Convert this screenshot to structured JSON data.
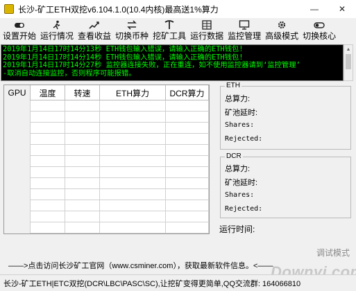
{
  "window": {
    "title": "长沙-矿工ETH双挖v6.104.1.0(10.4内核)最高送1%算力",
    "minimize_icon": "minimize-icon",
    "close_icon": "close-icon",
    "minimize_glyph": "—",
    "close_glyph": "✕"
  },
  "toolbar": {
    "items": [
      {
        "label": "设置开始",
        "icon": "toggle-icon"
      },
      {
        "label": "运行情况",
        "icon": "runner-icon"
      },
      {
        "label": "查看收益",
        "icon": "chart-icon"
      },
      {
        "label": "切换币种",
        "icon": "exchange-icon"
      },
      {
        "label": "挖矿工具",
        "icon": "pickaxe-icon"
      },
      {
        "label": "运行数据",
        "icon": "grid-icon"
      },
      {
        "label": "监控管理",
        "icon": "monitor-icon"
      },
      {
        "label": "高级模式",
        "icon": "gear-icon"
      },
      {
        "label": "切换核心",
        "icon": "switch-icon"
      }
    ]
  },
  "log": {
    "lines": [
      "2019年1月14日17时14分13秒 ETH钱包输入错误，请输入正确的ETH钱包!",
      "2019年1月14日17时14分14秒 ETH钱包输入错误，请输入正确的ETH钱包!",
      "2019年1月14日17时14分27秒 监控器连接失败，正在重连，如不使用监控器请到‘监控管理’",
      "-取消自动连接监控，否则程序可能报错。"
    ],
    "color": "#00ff00",
    "background": "#000000"
  },
  "table": {
    "columns": [
      "GPU",
      "温度",
      "转速",
      "ETH算力",
      "DCR算力"
    ],
    "rows": [
      [
        "",
        "",
        "",
        "",
        ""
      ],
      [
        "",
        "",
        "",
        "",
        ""
      ],
      [
        "",
        "",
        "",
        "",
        ""
      ],
      [
        "",
        "",
        "",
        "",
        ""
      ],
      [
        "",
        "",
        "",
        "",
        ""
      ],
      [
        "",
        "",
        "",
        "",
        ""
      ],
      [
        "",
        "",
        "",
        "",
        ""
      ],
      [
        "",
        "",
        "",
        "",
        ""
      ],
      [
        "",
        "",
        "",
        "",
        ""
      ],
      [
        "",
        "",
        "",
        "",
        ""
      ],
      [
        "",
        "",
        "",
        "",
        ""
      ],
      [
        "",
        "",
        "",
        "",
        ""
      ]
    ]
  },
  "eth_panel": {
    "title": "ETH",
    "hashrate_label": "总算力:",
    "pool_latency_label": "矿池延时:",
    "shares_label": "Shares:",
    "rejected_label": "Rejected:"
  },
  "dcr_panel": {
    "title": "DCR",
    "hashrate_label": "总算力:",
    "pool_latency_label": "矿池延时:",
    "shares_label": "Shares:",
    "rejected_label": "Rejected:"
  },
  "runtime_label": "运行时间:",
  "debug_mode": "调试模式",
  "website_link": "——>点击访问长沙矿工官网（www.csminer.com），获取最新软件信息。<——",
  "status_bar": "长沙-矿工ETH|ETC双挖(DCR\\LBC\\PASC\\SC),让挖矿变得更简单,QQ交流群: 164066810",
  "watermark": "Downyi.com"
}
